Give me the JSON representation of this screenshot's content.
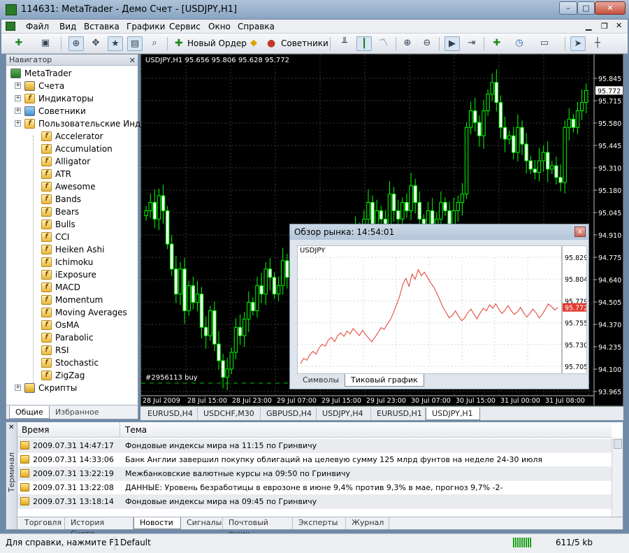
{
  "window": {
    "title": "114631: MetaTrader - Демо Счет - [USDJPY,H1]",
    "minimize": "–",
    "maximize": "□",
    "close": "✕"
  },
  "menu": [
    "Файл",
    "Вид",
    "Вставка",
    "Графики",
    "Сервис",
    "Окно",
    "Справка"
  ],
  "toolbar": {
    "new_order": "Новый Ордер",
    "experts": "Советники"
  },
  "navigator": {
    "header": "Навигатор",
    "root": "MetaTrader",
    "accounts": "Счета",
    "indicators": "Индикаторы",
    "advisors": "Советники",
    "custom": "Пользовательские Инди",
    "custom_items": [
      "Accelerator",
      "Accumulation",
      "Alligator",
      "ATR",
      "Awesome",
      "Bands",
      "Bears",
      "Bulls",
      "CCI",
      "Heiken Ashi",
      "Ichimoku",
      "iExposure",
      "MACD",
      "Momentum",
      "Moving Averages",
      "OsMA",
      "Parabolic",
      "RSI",
      "Stochastic",
      "ZigZag"
    ],
    "scripts": "Скрипты",
    "tabs": [
      "Общие",
      "Избранное"
    ]
  },
  "chart": {
    "info": "USDJPY,H1  95.656 95.806 95.628 95.772",
    "price_labels": [
      "95.845",
      "95.715",
      "95.580",
      "95.445",
      "95.310",
      "95.180",
      "95.045",
      "94.910",
      "94.775",
      "94.640",
      "94.505",
      "94.370",
      "94.235",
      "94.100",
      "93.965"
    ],
    "current_price": "95.772",
    "time_labels": [
      "28 Jul 2009",
      "28 Jul 15:00",
      "28 Jul 23:00",
      "29 Jul 07:00",
      "29 Jul 15:00",
      "29 Jul 23:00",
      "30 Jul 07:00",
      "30 Jul 15:00",
      "31 Jul 00:00",
      "31 Jul 08:00"
    ],
    "order_label": "#2956113 buy",
    "tabs": [
      "EURUSD,H4",
      "USDCHF,M30",
      "GBPUSD,H4",
      "USDJPY,H4",
      "EURUSD,H1",
      "USDJPY,H1"
    ],
    "active_tab": "USDJPY,H1",
    "candle_color": "#00ff00",
    "background": "#000000"
  },
  "market_watch": {
    "title": "Обзор рынка: 14:54:01",
    "close": "x",
    "symbol": "USDJPY",
    "price_labels": [
      "95.829",
      "95.804",
      "95.779",
      "95.755",
      "95.730",
      "95.705"
    ],
    "current": "95.772",
    "tabs": [
      "Символы",
      "Тиковый график"
    ],
    "active_tab": "Тиковый график",
    "line_color": "#e23a2e"
  },
  "terminal": {
    "side_label": "Терминал",
    "headers": {
      "time": "Время",
      "subject": "Тема"
    },
    "rows": [
      {
        "time": "2009.07.31 14:47:17",
        "subject": "Фондовые индексы мира на 11:15 по Гринвичу"
      },
      {
        "time": "2009.07.31 14:33:06",
        "subject": "Банк Англии завершил покупку облигаций на целевую сумму 125 млрд фунтов на неделе 24-30 июля"
      },
      {
        "time": "2009.07.31 13:22:19",
        "subject": "Межбанковские валютные курсы на 09:50 по Гринвичу"
      },
      {
        "time": "2009.07.31 13:22:08",
        "subject": "ДАННЫЕ: Уровень безработицы в еврозоне в июне 9,4% против 9,3% в мае, прогноз 9,7% -2-"
      },
      {
        "time": "2009.07.31 13:18:14",
        "subject": "Фондовые индексы мира на 09:45 по Гринвичу"
      }
    ],
    "tabs": [
      "Торговля",
      "История Счета",
      "Новости",
      "Сигналы",
      "Почтовый ящик",
      "Эксперты",
      "Журнал"
    ],
    "active_tab": "Новости"
  },
  "status": {
    "help": "Для справки, нажмите F1",
    "profile": "Default",
    "traffic": "611/5 kb"
  }
}
